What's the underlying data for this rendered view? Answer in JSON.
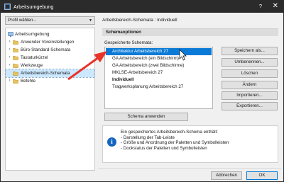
{
  "window": {
    "title": "Arbeitsumgebung",
    "help": "?",
    "close": "✕"
  },
  "profile": {
    "label": "Profil wählen..."
  },
  "tree": {
    "items": [
      {
        "label": "Arbeitsumgebung",
        "expander": "",
        "icon": "monitor-icon"
      },
      {
        "label": "Anwender Voreinstellungen",
        "expander": "›",
        "icon": "folder-icon"
      },
      {
        "label": "Büro-Standard-Schemata",
        "expander": "›",
        "icon": "folder-icon"
      },
      {
        "label": "Tastaturkürzel",
        "expander": "›",
        "icon": "folder-icon"
      },
      {
        "label": "Werkzeuge",
        "expander": "›",
        "icon": "folder-icon"
      },
      {
        "label": "Arbeitsbereich-Schemata",
        "expander": "",
        "icon": "folder-icon",
        "selected": true
      },
      {
        "label": "Befehle",
        "expander": "›",
        "icon": "folder-icon"
      }
    ]
  },
  "breadcrumb": {
    "text": "Arbeitsbereich-Schemata : Individuell"
  },
  "schema": {
    "header": "Schemaoptionen",
    "saved_label": "Gespeicherte Schemata:",
    "list": [
      {
        "label": "Architektur Arbeitsbereich 27",
        "selected": true
      },
      {
        "label": "GA Arbeitsbereich (ein Bildschirm)"
      },
      {
        "label": "GA Arbeitsbereich (zwei Bildschirme)"
      },
      {
        "label": "MKLSE-Arbeitsbereich 27"
      },
      {
        "label": "Individuell",
        "bold": true
      },
      {
        "label": "Tragwerksplanung Arbeitsbereich 27"
      }
    ],
    "apply": "Schema anwenden"
  },
  "side_buttons": [
    "Speichern als...",
    "Umbenennen...",
    "Löschen",
    "Ändern",
    "Importieren...",
    "Exportieren..."
  ],
  "info": {
    "icon": "i",
    "lines": [
      "Ein gespeichertes Arbeitsbereich-Schema enthält:",
      "- Darstellung der Tab-Leiste",
      "- Größe und Anordnung der Paletten und Symbolleisten",
      "- Dockstatus der Paletten und Symbolleisten"
    ]
  },
  "footer": {
    "cancel": "Abbrechen",
    "ok": "OK"
  },
  "colors": {
    "selection": "#0a7ad6",
    "titlebar": "#2b2b2b",
    "arrow": "#e8332a",
    "info_icon": "#1565c0"
  }
}
